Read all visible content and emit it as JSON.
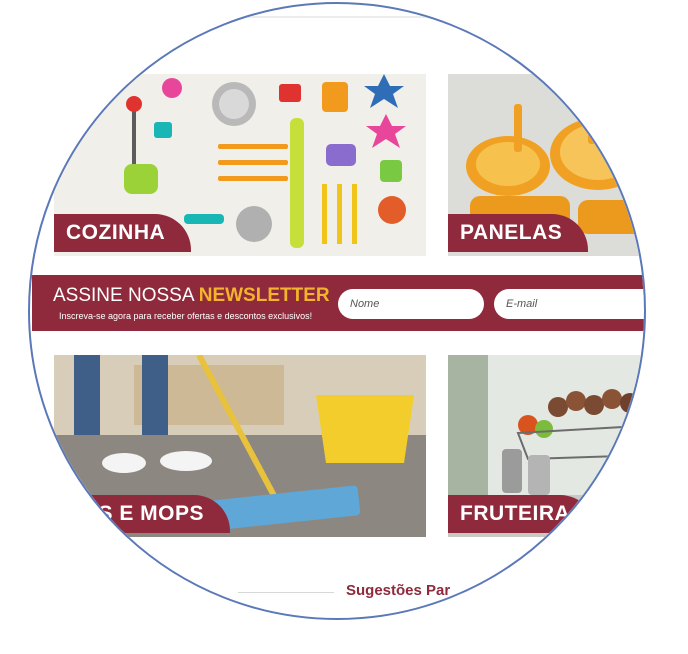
{
  "categories": [
    {
      "label": "COZINHA"
    },
    {
      "label": "PANELAS"
    },
    {
      "label": "DOS E MOPS"
    },
    {
      "label": "FRUTEIRA"
    }
  ],
  "newsletter": {
    "title_prefix": "ASSINE NOSSA ",
    "title_highlight": "NEWSLETTER",
    "subtitle": "Inscreva-se agora para receber ofertas e descontos exclusivos!",
    "name_placeholder": "Nome",
    "email_placeholder": "E-mail"
  },
  "suggestions_heading": "Sugestões Par",
  "colors": {
    "brand": "#8f2a3c",
    "accent": "#f4b32c",
    "circle_border": "#5b78b8"
  }
}
